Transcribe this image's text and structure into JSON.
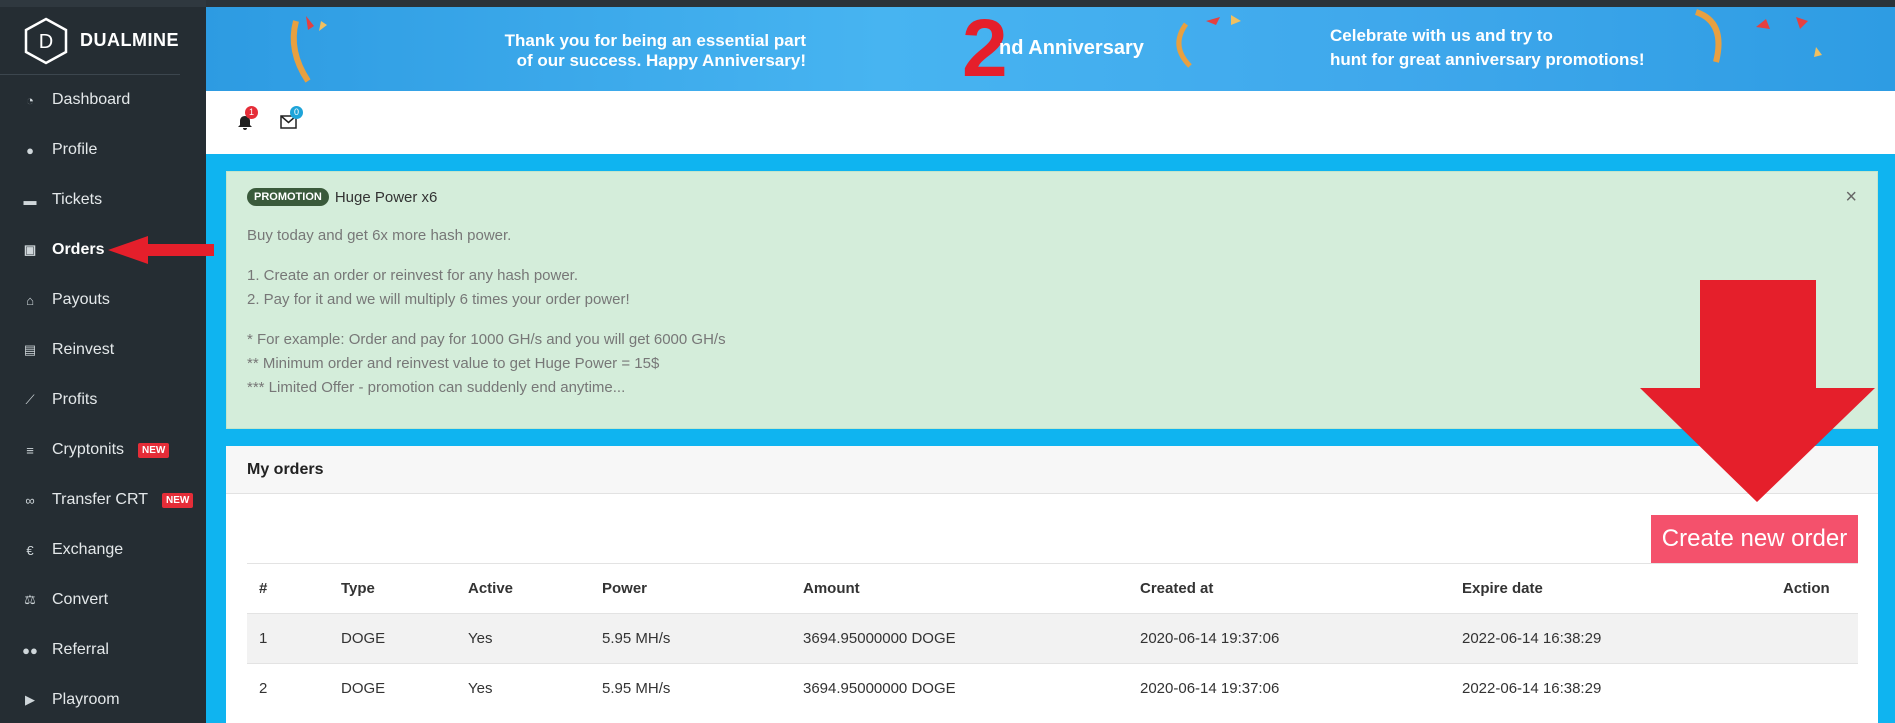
{
  "brand": {
    "name": "DUALMINE",
    "logo_letter": "D"
  },
  "sidebar": {
    "items": [
      {
        "label": "Dashboard",
        "icon": "dashboard-icon"
      },
      {
        "label": "Profile",
        "icon": "user-icon"
      },
      {
        "label": "Tickets",
        "icon": "ticket-icon"
      },
      {
        "label": "Orders",
        "icon": "money-icon",
        "active": true
      },
      {
        "label": "Payouts",
        "icon": "bank-icon"
      },
      {
        "label": "Reinvest",
        "icon": "cash-icon"
      },
      {
        "label": "Profits",
        "icon": "chart-icon"
      },
      {
        "label": "Cryptonits",
        "icon": "coins-icon",
        "badge": "NEW"
      },
      {
        "label": "Transfer CRT",
        "icon": "link-icon",
        "badge": "NEW"
      },
      {
        "label": "Exchange",
        "icon": "euro-icon"
      },
      {
        "label": "Convert",
        "icon": "scale-icon"
      },
      {
        "label": "Referral",
        "icon": "users-icon"
      },
      {
        "label": "Playroom",
        "icon": "play-icon"
      }
    ]
  },
  "banner": {
    "left_text_1": "Thank you for being an essential part",
    "left_text_2": "of our success. Happy Anniversary!",
    "number": "2",
    "number_suffix": "nd Anniversary",
    "right_text_1": "Celebrate with us and try to",
    "right_text_2": "hunt for great anniversary promotions!"
  },
  "header": {
    "notifications_count": "1",
    "messages_count": "0"
  },
  "promo": {
    "tag": "PROMOTION",
    "title": "Huge Power x6",
    "close": "×",
    "lines": [
      "Buy today and get 6x more hash power.",
      "1. Create an order or reinvest for any hash power.",
      "2. Pay for it and we will multiply 6 times your order power!",
      "* For example: Order and pay for 1000 GH/s and you will get 6000 GH/s",
      "** Minimum order and reinvest value to get Huge Power = 15$",
      "*** Limited Offer - promotion can suddenly end anytime..."
    ]
  },
  "orders": {
    "title": "My orders",
    "create_button": "Create new order",
    "columns": [
      "#",
      "Type",
      "Active",
      "Power",
      "Amount",
      "Created at",
      "Expire date",
      "Action"
    ],
    "rows": [
      [
        "1",
        "DOGE",
        "Yes",
        "5.95 MH/s",
        "3694.95000000 DOGE",
        "2020-06-14 19:37:06",
        "2022-06-14 16:38:29",
        ""
      ],
      [
        "2",
        "DOGE",
        "Yes",
        "5.95 MH/s",
        "3694.95000000 DOGE",
        "2020-06-14 19:37:06",
        "2022-06-14 16:38:29",
        ""
      ]
    ]
  },
  "colors": {
    "sidebar_bg": "#252d33",
    "page_bg": "#0fb4f0",
    "promo_bg": "#d4edda",
    "create_button": "#f4516c",
    "annotation_red": "#e51f2b",
    "badge_new": "#e52d38"
  }
}
